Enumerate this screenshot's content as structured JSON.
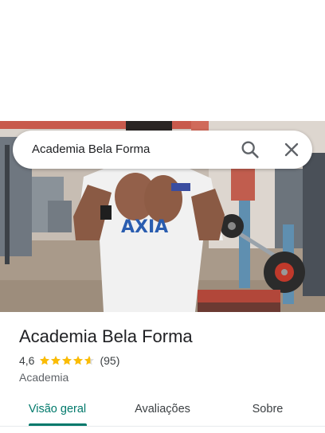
{
  "search": {
    "query": "Academia Bela Forma"
  },
  "place": {
    "title": "Academia Bela Forma",
    "rating": "4,6",
    "stars_value": 4.6,
    "review_count": "(95)",
    "category": "Academia"
  },
  "tabs": [
    {
      "label": "Visão geral",
      "active": true
    },
    {
      "label": "Avaliações",
      "active": false
    },
    {
      "label": "Sobre",
      "active": false
    }
  ],
  "photo": {
    "shirt_text": "AXIA"
  },
  "colors": {
    "accent": "#00796b",
    "star": "#fbbc04",
    "text_primary": "#202124",
    "text_secondary": "#5f6368"
  },
  "icons": {
    "search": "search-icon",
    "close": "close-icon",
    "star": "star-icon"
  }
}
